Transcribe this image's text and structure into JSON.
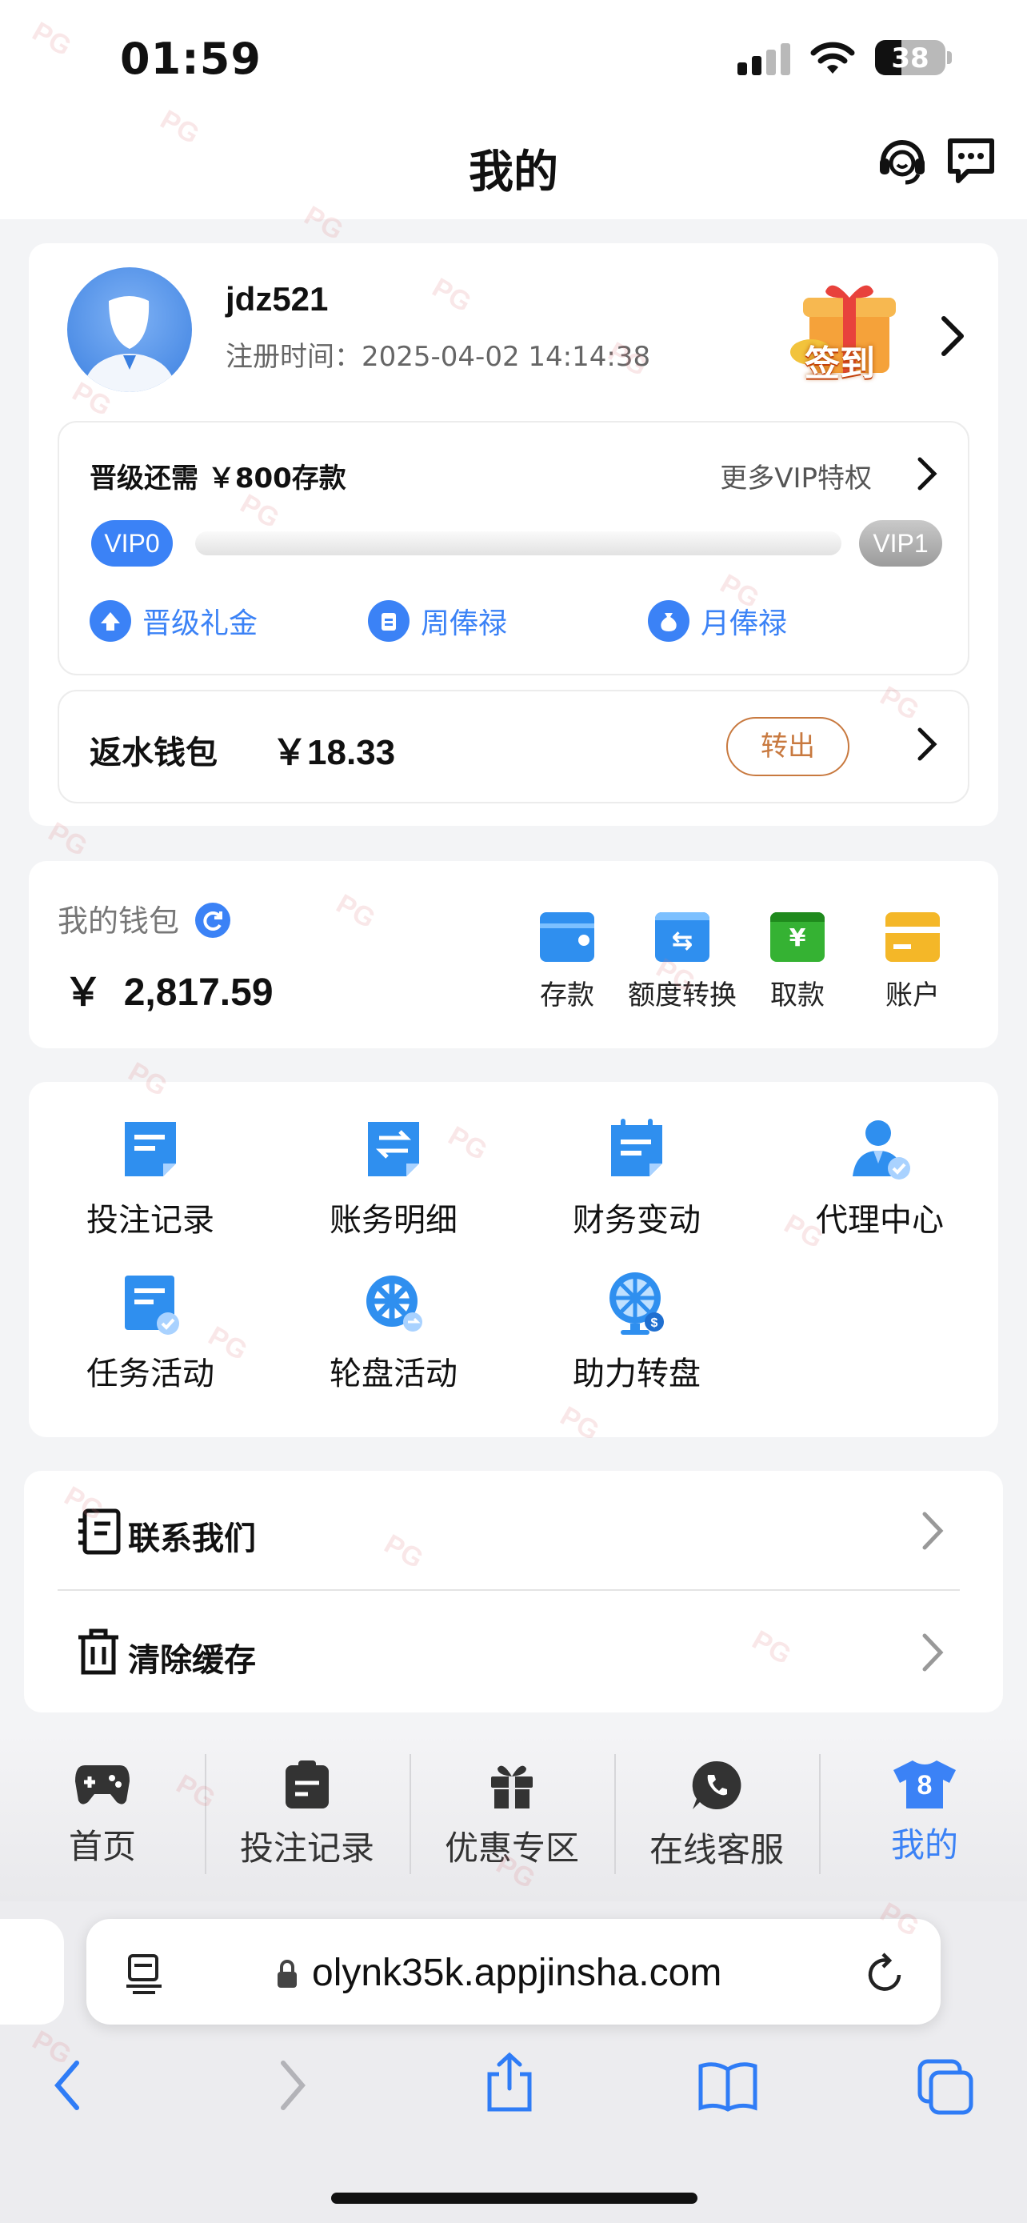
{
  "status_bar": {
    "time": "01:59",
    "battery": "38",
    "battery_level": 0.38
  },
  "header": {
    "title": "我的",
    "support_icon": "headset-icon",
    "message_icon": "chat-bubble-icon"
  },
  "profile": {
    "username": "jdz521",
    "register_time": "注册时间：2025-04-02 14:14:38",
    "signin_label": "签到"
  },
  "vip": {
    "need_text": "晋级还需 ￥800存款",
    "more_text": "更多VIP特权",
    "current_level": "VIP0",
    "next_level": "VIP1",
    "progress": 0,
    "perks": [
      {
        "label": "晋级礼金",
        "icon": "arrow-up-icon"
      },
      {
        "label": "周俸禄",
        "icon": "clipboard-icon"
      },
      {
        "label": "月俸禄",
        "icon": "money-bag-icon"
      }
    ]
  },
  "rebate": {
    "label": "返水钱包",
    "amount": "￥18.33",
    "button": "转出"
  },
  "wallet": {
    "label": "我的钱包",
    "currency": "￥",
    "amount": "2,817.59",
    "actions": [
      {
        "label": "存款",
        "icon": "wallet-icon",
        "color": "#2f8fef"
      },
      {
        "label": "额度转换",
        "icon": "transfer-icon",
        "color": "#2f8fef"
      },
      {
        "label": "取款",
        "icon": "withdraw-icon",
        "color": "#35b233"
      },
      {
        "label": "账户",
        "icon": "card-icon",
        "color": "#f4b728"
      }
    ]
  },
  "features": [
    {
      "label": "投注记录",
      "icon": "bet-record-icon"
    },
    {
      "label": "账务明细",
      "icon": "account-detail-icon"
    },
    {
      "label": "财务变动",
      "icon": "finance-change-icon"
    },
    {
      "label": "代理中心",
      "icon": "agent-icon"
    },
    {
      "label": "任务活动",
      "icon": "task-icon"
    },
    {
      "label": "轮盘活动",
      "icon": "wheel-icon"
    },
    {
      "label": "助力转盘",
      "icon": "prize-wheel-icon"
    }
  ],
  "list": [
    {
      "label": "联系我们",
      "icon": "contact-icon"
    },
    {
      "label": "清除缓存",
      "icon": "trash-icon"
    }
  ],
  "tabbar": [
    {
      "label": "首页",
      "icon": "gamepad-icon"
    },
    {
      "label": "投注记录",
      "icon": "clipboard-edit-icon"
    },
    {
      "label": "优惠专区",
      "icon": "gift-icon"
    },
    {
      "label": "在线客服",
      "icon": "whatsapp-icon"
    },
    {
      "label": "我的",
      "icon": "jersey-icon",
      "badge": "8",
      "active": true
    }
  ],
  "browser": {
    "url": "olynk35k.appjinsha.com"
  },
  "colors": {
    "accent": "#3b82f6",
    "rebate_button": "#c8793f"
  }
}
